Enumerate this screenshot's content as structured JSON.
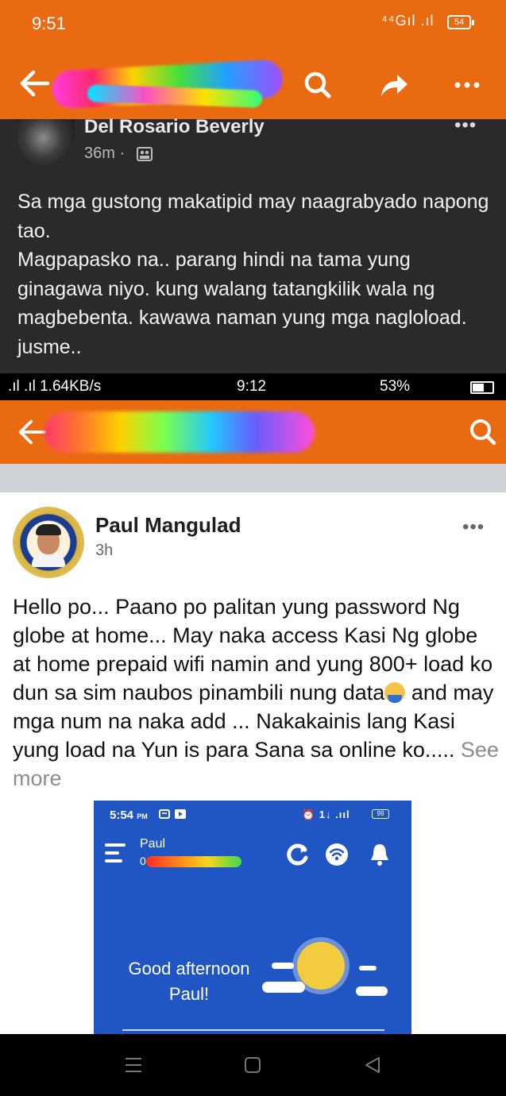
{
  "top_screenshot": {
    "status": {
      "time": "9:51",
      "signal": "⁴⁴Gıl .ıl",
      "battery": "54"
    },
    "post": {
      "author": "Del Rosario Beverly",
      "time": "36m ·",
      "more": "•••",
      "body": "Sa mga gustong makatipid may naagrabyado napong tao.\nMagpapasko na.. parang hindi na tama yung ginagawa niyo. kung walang tatangkilik wala ng magbebenta. kawawa naman yung mga nagloload. jusme.."
    },
    "icons": [
      "back-arrow-icon",
      "search-icon",
      "share-icon",
      "more-icon",
      "friends-icon"
    ]
  },
  "middle_status": {
    "left": ".ıl .ıl 1.64KB/s",
    "time": "9:12",
    "battery": "53%"
  },
  "bottom_screenshot": {
    "post": {
      "author": "Paul Mangulad",
      "time": "3h",
      "more": "•••",
      "body_before_emoji": "Hello po... Paano po palitan yung password Ng globe at home... May naka access Kasi Ng globe at home prepaid wifi namin and yung 800+ load ko dun sa sim naubos pinambili nung data",
      "body_after_emoji": " and may mga num na naka add ... Nakakainis lang Kasi yung load na Yun is para Sana sa online ko..... ",
      "see_more": "See more"
    },
    "embedded_app": {
      "time": "5:54",
      "time_suffix": "PM",
      "status_icons": "⏰ 1↓ .ııl",
      "battery": "99",
      "user_name": "Paul",
      "balance": "0",
      "greeting_line1": "Good afternoon",
      "greeting_line2": "Paul!",
      "colors": {
        "background": "#1f56c4",
        "sun": "#f3cb3e"
      }
    }
  },
  "navigation": {
    "buttons": [
      "menu",
      "home",
      "back"
    ]
  },
  "colors": {
    "brand_orange": "#ea6a12",
    "dark_post": "#2a2a2c"
  }
}
